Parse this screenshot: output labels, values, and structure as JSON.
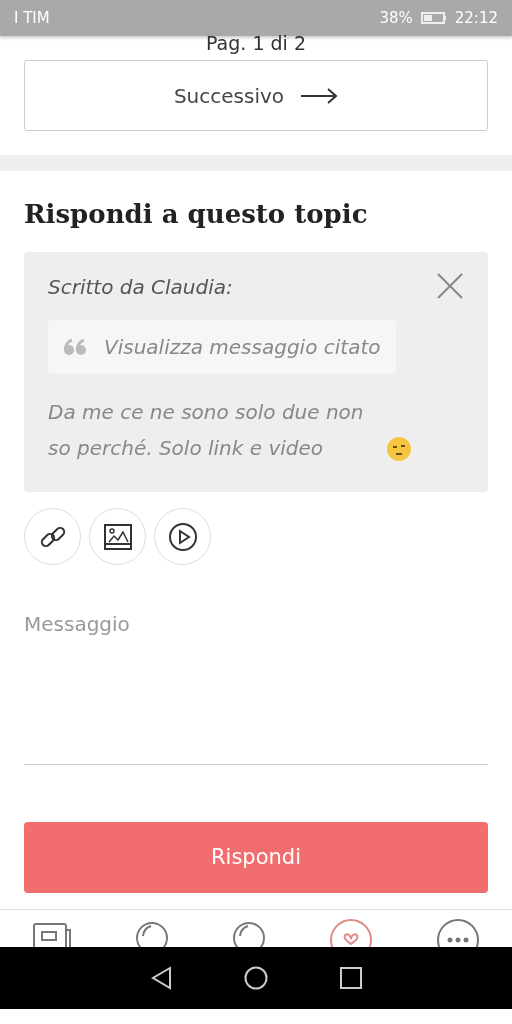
{
  "status_bar": {
    "carrier": "I TIM",
    "battery": "38%",
    "time": "22:12"
  },
  "pagination": {
    "label": "Pag. 1 di 2",
    "next_button": "Successivo"
  },
  "reply": {
    "title": "Rispondi a questo topic",
    "quote": {
      "author": "Scritto da Claudia:",
      "toggle": "Visualizza messaggio citato",
      "text": "Da me ce ne sono solo due non so perché. Solo link e video"
    },
    "attachments": [
      {
        "kind": "link"
      },
      {
        "kind": "image"
      },
      {
        "kind": "video"
      }
    ],
    "message": {
      "placeholder": "Messaggio"
    },
    "submit": "Rispondi"
  },
  "bottom_nav": [
    {
      "kind": "diary",
      "selected": false
    },
    {
      "kind": "bubble",
      "selected": false
    },
    {
      "kind": "bubble",
      "selected": false
    },
    {
      "kind": "heart",
      "selected": true
    },
    {
      "kind": "more",
      "selected": false
    }
  ]
}
